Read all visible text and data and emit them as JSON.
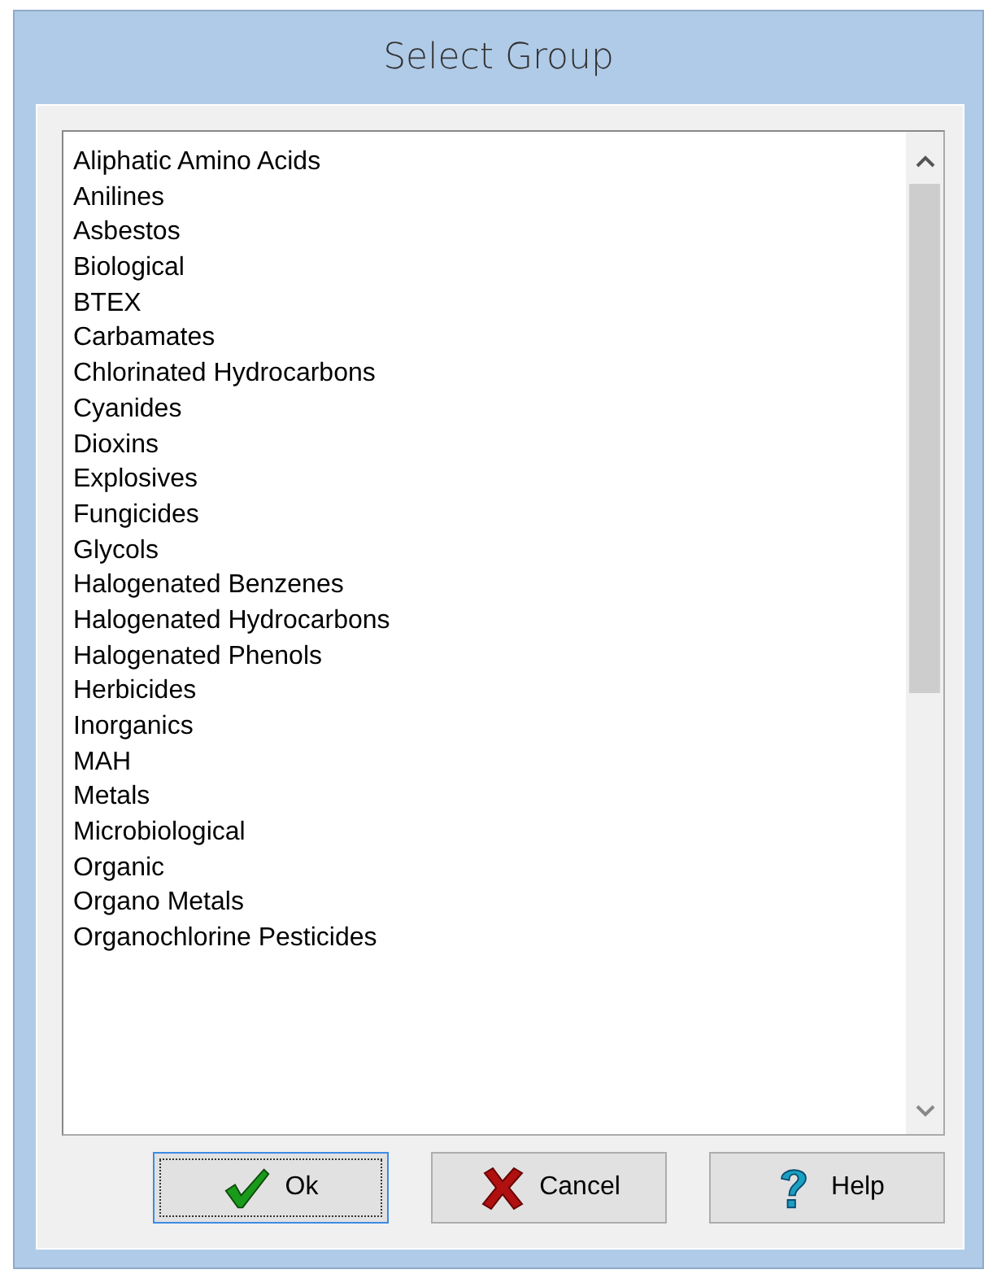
{
  "window": {
    "title": "Select Group"
  },
  "list": {
    "items": [
      {
        "label": "Aliphatic Amino Acids"
      },
      {
        "label": "Anilines"
      },
      {
        "label": "Asbestos"
      },
      {
        "label": "Biological"
      },
      {
        "label": "BTEX"
      },
      {
        "label": "Carbamates"
      },
      {
        "label": "Chlorinated Hydrocarbons"
      },
      {
        "label": "Cyanides"
      },
      {
        "label": "Dioxins"
      },
      {
        "label": "Explosives"
      },
      {
        "label": "Fungicides"
      },
      {
        "label": "Glycols"
      },
      {
        "label": "Halogenated Benzenes"
      },
      {
        "label": "Halogenated Hydrocarbons"
      },
      {
        "label": "Halogenated Phenols"
      },
      {
        "label": "Herbicides"
      },
      {
        "label": "Inorganics"
      },
      {
        "label": "MAH"
      },
      {
        "label": "Metals"
      },
      {
        "label": "Microbiological"
      },
      {
        "label": "Organic"
      },
      {
        "label": "Organo Metals"
      },
      {
        "label": "Organochlorine Pesticides"
      }
    ]
  },
  "buttons": [
    {
      "kind": "ok",
      "label": "Ok",
      "focused": true
    },
    {
      "kind": "cancel",
      "label": "Cancel",
      "focused": false
    },
    {
      "kind": "help",
      "label": "Help",
      "focused": false
    }
  ]
}
